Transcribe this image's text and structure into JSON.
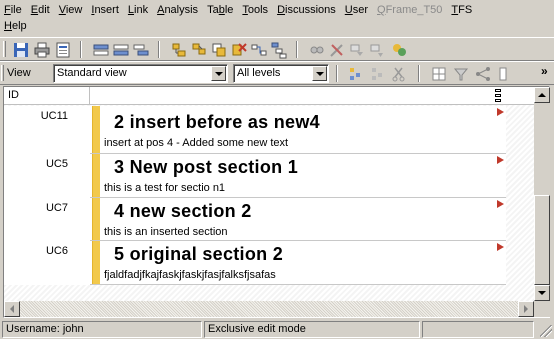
{
  "menu": {
    "items": [
      {
        "key": "F",
        "rest": "ile",
        "enabled": true
      },
      {
        "key": "E",
        "rest": "dit",
        "enabled": true
      },
      {
        "key": "V",
        "rest": "iew",
        "enabled": true
      },
      {
        "key": "I",
        "rest": "nsert",
        "enabled": true
      },
      {
        "key": "L",
        "rest": "ink",
        "enabled": true
      },
      {
        "key": "A",
        "rest": "nalysis",
        "enabled": true
      },
      {
        "pre": "Ta",
        "key": "b",
        "rest": "le",
        "enabled": true
      },
      {
        "key": "T",
        "rest": "ools",
        "enabled": true
      },
      {
        "key": "D",
        "rest": "iscussions",
        "enabled": true
      },
      {
        "key": "U",
        "rest": "ser",
        "enabled": true
      },
      {
        "key": "Q",
        "rest": "Frame_T50",
        "enabled": false
      },
      {
        "key": "T",
        "rest": "FS",
        "enabled": true
      }
    ],
    "help": {
      "key": "H",
      "rest": "elp"
    }
  },
  "toolbar2": {
    "view_label": "View",
    "view_value": "Standard view",
    "level_value": "All levels",
    "overflow": "»"
  },
  "table": {
    "id_header": "ID"
  },
  "sections": [
    {
      "id": "UC11",
      "title": "2 insert before as new4",
      "text": "insert at pos 4 - Added some new text"
    },
    {
      "id": "UC5",
      "title": "3 New post section 1",
      "text": "this is a test for sectio n1"
    },
    {
      "id": "UC7",
      "title": "4 new section 2",
      "text": "this is an inserted section"
    },
    {
      "id": "UC6",
      "title": "5 original section 2",
      "text": "fjaldfadjfkajfaskjfaskjfasjfalksfjsafas"
    }
  ],
  "status": {
    "username": "Username: john",
    "mode": "Exclusive edit mode"
  },
  "colors": {
    "section_bar": "#f2c94c",
    "marker": "#c0392b",
    "chrome": "#d4d0c8"
  }
}
